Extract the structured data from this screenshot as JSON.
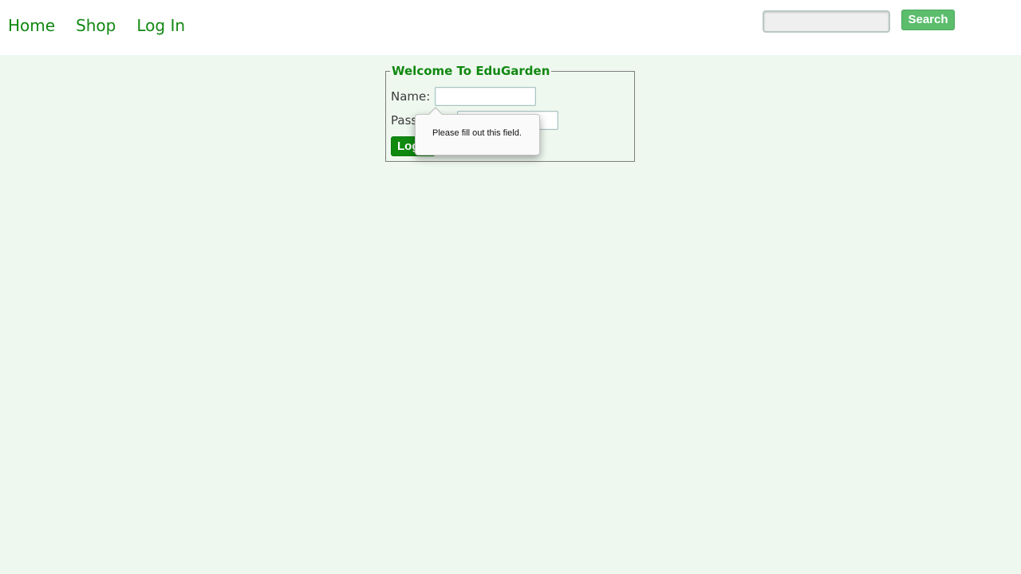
{
  "nav": {
    "items": [
      {
        "label": "Home"
      },
      {
        "label": "Shop"
      },
      {
        "label": "Log In"
      }
    ]
  },
  "search": {
    "value": "",
    "button_label": "Search"
  },
  "login_form": {
    "legend": "Welcome To EduGarden",
    "name_label": "Name:",
    "name_value": "",
    "password_label": "Password:",
    "password_value": "",
    "submit_label": "Log In"
  },
  "validation_tooltip": {
    "message": "Please fill out this field."
  },
  "colors": {
    "brand_green": "#118811",
    "page_background": "#eef8ef",
    "search_button": "#5cbd6d",
    "login_button": "#0f8a0f"
  }
}
